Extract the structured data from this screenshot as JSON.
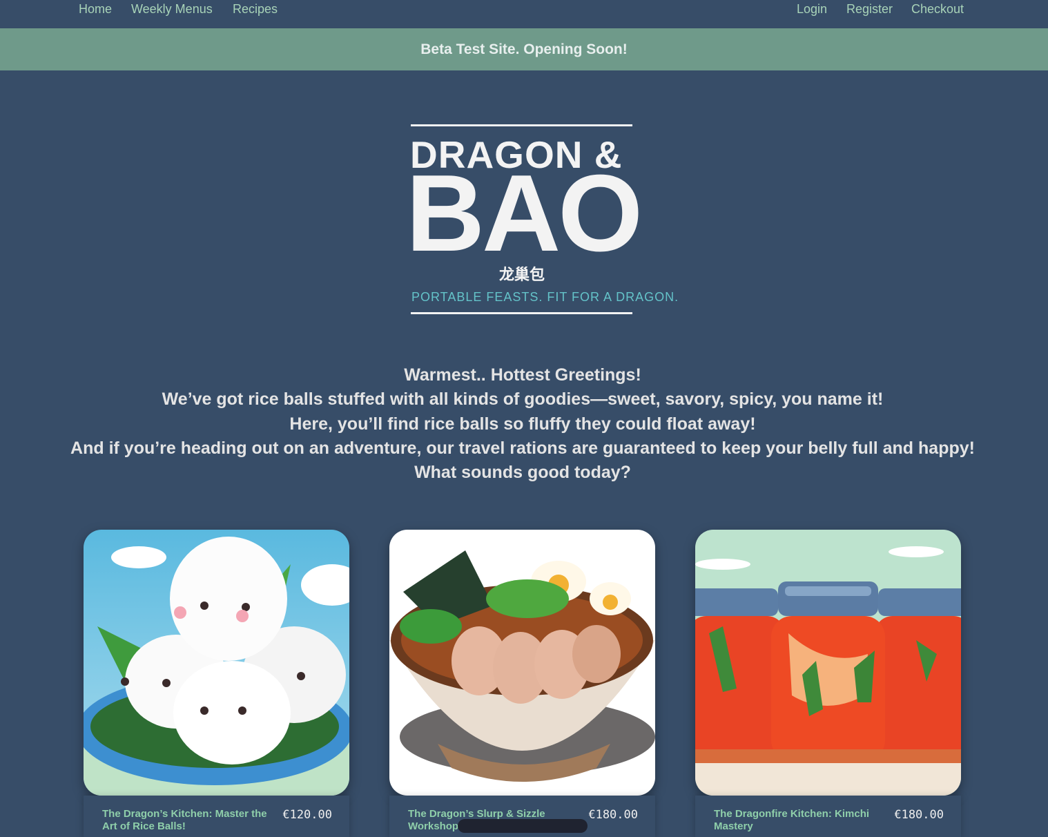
{
  "nav": {
    "left": [
      "Home",
      "Weekly Menus",
      "Recipes"
    ],
    "right": [
      "Login",
      "Register",
      "Checkout"
    ]
  },
  "banner": "Beta Test Site. Opening Soon!",
  "logo": {
    "line1": "DRAGON &",
    "line2": "BAO",
    "chinese": "龙巢包",
    "tagline": "PORTABLE FEASTS.  FIT FOR A DRAGON."
  },
  "greeting": [
    "Warmest.. Hottest Greetings!",
    "We’ve got rice balls stuffed with all kinds of goodies—sweet, savory, spicy, you name it!",
    "Here, you’ll find rice balls so fluffy they could float away!",
    "And if you’re heading out on an adventure, our travel rations are guaranteed to keep your belly full and happy!",
    "What sounds good today?"
  ],
  "products": [
    {
      "title": "The Dragon’s Kitchen: Master the Art of Rice Balls!",
      "price": "€120.00",
      "image": "rice-balls-illustration"
    },
    {
      "title": "The Dragon’s Slurp & Sizzle Workshop",
      "price": "€180.00",
      "image": "ramen-bowl-illustration"
    },
    {
      "title": "The Dragonfire Kitchen: Kimchi Mastery",
      "price": "€180.00",
      "image": "kimchi-jars-illustration"
    }
  ],
  "colors": {
    "background": "#374d68",
    "banner": "#6f9a8a",
    "nav_link": "#a8d3b8",
    "tagline": "#64c3c9"
  }
}
